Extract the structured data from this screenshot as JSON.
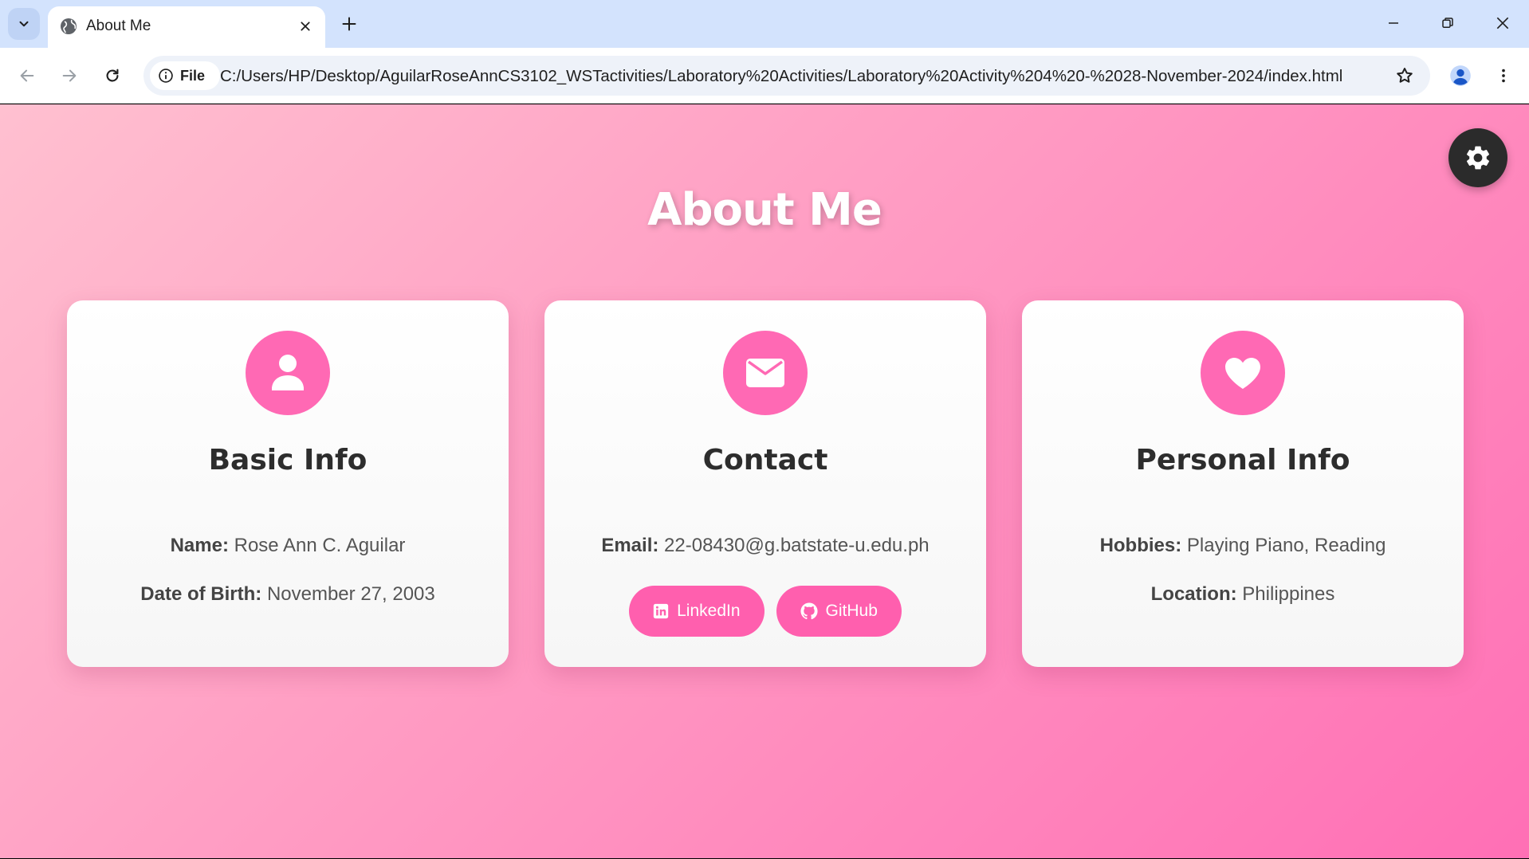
{
  "browser": {
    "tab": {
      "title": "About Me"
    },
    "omnibox": {
      "chip_label": "File",
      "url": "C:/Users/HP/Desktop/AguilarRoseAnnCS3102_WSTactivities/Laboratory%20Activities/Laboratory%20Activity%204%20-%2028-November-2024/index.html"
    }
  },
  "page": {
    "title": "About Me",
    "cards": {
      "basic": {
        "icon": "user-icon",
        "title": "Basic Info",
        "name_label": "Name:",
        "name_value": "Rose Ann C. Aguilar",
        "dob_label": "Date of Birth:",
        "dob_value": "November 27, 2003"
      },
      "contact": {
        "icon": "envelope-icon",
        "title": "Contact",
        "email_label": "Email:",
        "email_value": "22-08430@g.batstate-u.edu.ph",
        "linkedin_label": "LinkedIn",
        "github_label": "GitHub"
      },
      "personal": {
        "icon": "heart-icon",
        "title": "Personal Info",
        "hobbies_label": "Hobbies:",
        "hobbies_value": "Playing Piano, Reading",
        "location_label": "Location:",
        "location_value": "Philippines"
      }
    }
  },
  "colors": {
    "accent": "#ff69b4",
    "toggle_bg": "#2b2b2b",
    "tabbar_bg": "#d3e3fd"
  }
}
